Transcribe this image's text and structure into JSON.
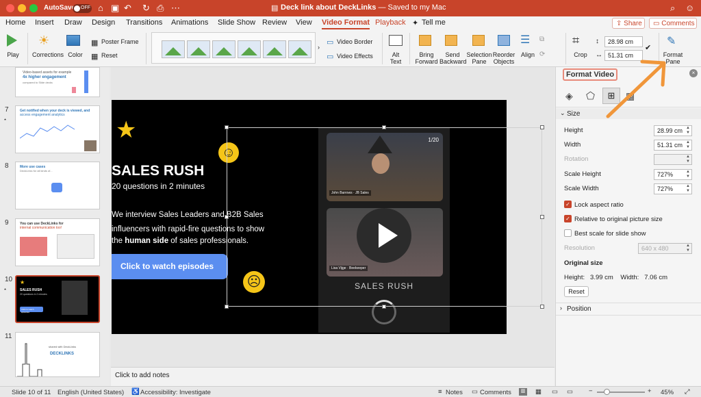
{
  "titlebar": {
    "autosave_label": "AutoSave",
    "autosave_state": "OFF",
    "doc_title": "Deck link about DeckLinks",
    "doc_status": "— Saved to my Mac"
  },
  "tabs": [
    "Home",
    "Insert",
    "Draw",
    "Design",
    "Transitions",
    "Animations",
    "Slide Show",
    "Review",
    "View",
    "Video Format",
    "Playback",
    "Tell me"
  ],
  "share_label": "Share",
  "comments_label": "Comments",
  "ribbon": {
    "play": "Play",
    "corrections": "Corrections",
    "color": "Color",
    "poster_frame": "Poster Frame",
    "reset": "Reset",
    "video_border": "Video Border",
    "video_effects": "Video Effects",
    "alt_text": "Alt Text",
    "alt_text_1": "Alt",
    "alt_text_2": "Text",
    "bring_forward_1": "Bring",
    "bring_forward_2": "Forward",
    "send_backward_1": "Send",
    "send_backward_2": "Backward",
    "selection_pane_1": "Selection",
    "selection_pane_2": "Pane",
    "reorder_objects_1": "Reorder",
    "reorder_objects_2": "Objects",
    "align": "Align",
    "crop": "Crop",
    "height": "28.98 cm",
    "width": "51.31 cm",
    "format_pane_1": "Format",
    "format_pane_2": "Pane"
  },
  "slides": [
    {
      "num": "",
      "line1": "Video-based assets for example",
      "line2": "4x higher engagement",
      "line3": "compared to Slide decks"
    },
    {
      "num": "7",
      "line1": "Get notified when your deck is viewed, and",
      "line2": "access engagement analytics"
    },
    {
      "num": "8",
      "line1": "More use cases",
      "line2": "DeckLinks for all kinds of..."
    },
    {
      "num": "9",
      "line1": "You can use DeckLinks for",
      "line2": "internal communication too!"
    },
    {
      "num": "10",
      "line1": "SALES RUSH",
      "line2": "20 questions in 2 minutes",
      "line3": "Click to watch episodes"
    },
    {
      "num": "11",
      "line1": "shared with DeckLinks",
      "line2": "DECKLINKS"
    }
  ],
  "slide": {
    "title": "SALES RUSH",
    "subtitle": "20 questions in 2 minutes",
    "body_1": "We interview Sales Leaders and B2B Sales",
    "body_2": "influencers with rapid-fire questions to show",
    "body_3a": "the ",
    "body_3b": "human side",
    "body_3c": " of sales professionals.",
    "cta": "Click to watch episodes",
    "video_name1": "John Barrows",
    "video_sub1": "JB Sales",
    "video_name2": "Lisa Vijge",
    "video_sub2": "Beekeeper",
    "video_caption": "SALES RUSH",
    "video_counter": "1/20"
  },
  "notes_placeholder": "Click to add notes",
  "pane": {
    "title": "Format Video",
    "size_section": "Size",
    "height_label": "Height",
    "height_value": "28.99 cm",
    "width_label": "Width",
    "width_value": "51.31 cm",
    "rotation_label": "Rotation",
    "scale_height_label": "Scale Height",
    "scale_height_value": "727%",
    "scale_width_label": "Scale Width",
    "scale_width_value": "727%",
    "lock_aspect": "Lock aspect ratio",
    "relative_original": "Relative to original picture size",
    "best_scale": "Best scale for slide show",
    "resolution_label": "Resolution",
    "resolution_value": "640 x 480",
    "original_size": "Original size",
    "orig_height_label": "Height:",
    "orig_height_value": "3.99 cm",
    "orig_width_label": "Width:",
    "orig_width_value": "7.06 cm",
    "reset": "Reset",
    "position_section": "Position"
  },
  "status": {
    "slide_pos": "Slide 10 of 11",
    "language": "English (United States)",
    "accessibility": "Accessibility: Investigate",
    "notes": "Notes",
    "comments": "Comments",
    "zoom": "45%"
  },
  "colors": {
    "accent": "#c8442a",
    "cta_blue": "#5b8ef0",
    "arrow": "#f0963a"
  }
}
